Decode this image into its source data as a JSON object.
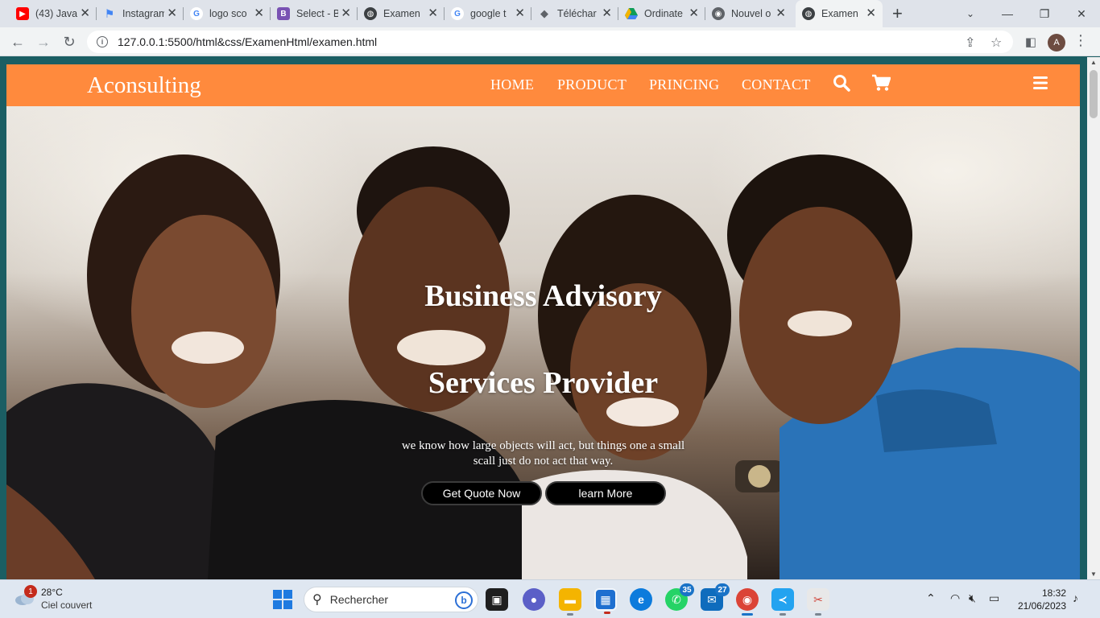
{
  "browser": {
    "tabs": [
      {
        "title": "(43) Java",
        "favicon": "youtube-icon",
        "color": "#ff0000"
      },
      {
        "title": "Instagram",
        "favicon": "flag-icon",
        "color": "#4285f4"
      },
      {
        "title": "logo sco",
        "favicon": "google-icon",
        "color": "#4285f4"
      },
      {
        "title": "Select - B",
        "favicon": "bootstrap-icon",
        "color": "#7952b3"
      },
      {
        "title": "Examen",
        "favicon": "globe-icon",
        "color": "#5f6368"
      },
      {
        "title": "google t",
        "favicon": "google-icon",
        "color": "#4285f4"
      },
      {
        "title": "Téléchar",
        "favicon": "graduation-cap-icon",
        "color": "#5f6368"
      },
      {
        "title": "Ordinate",
        "favicon": "google-drive-icon",
        "color": "#0f9d58"
      },
      {
        "title": "Nouvel o",
        "favicon": "chrome-icon",
        "color": "#5f6368"
      },
      {
        "title": "Examen",
        "favicon": "globe-icon",
        "color": "#5f6368",
        "active": true
      }
    ],
    "url": "127.0.0.1:5500/html&css/ExamenHtml/examen.html",
    "profile_initial": "A"
  },
  "site": {
    "brand": "Aconsulting",
    "nav": [
      "HOME",
      "PRODUCT",
      "PRINCING",
      "CONTACT"
    ],
    "accent": "#ff8a3d",
    "hero": {
      "title_line1": "Business Advisory",
      "title_line2": "Services Provider",
      "subtitle": "we know how large objects will act, but things one a small scall just do not act that way.",
      "primary_button": "Get Quote Now",
      "secondary_button": "learn More"
    }
  },
  "taskbar": {
    "weather": {
      "temp": "28°C",
      "desc": "Ciel couvert",
      "badge": "1"
    },
    "search_label": "Rechercher",
    "badges": {
      "whatsapp": "35",
      "mail": "27"
    },
    "time": "18:32",
    "date": "21/06/2023"
  }
}
